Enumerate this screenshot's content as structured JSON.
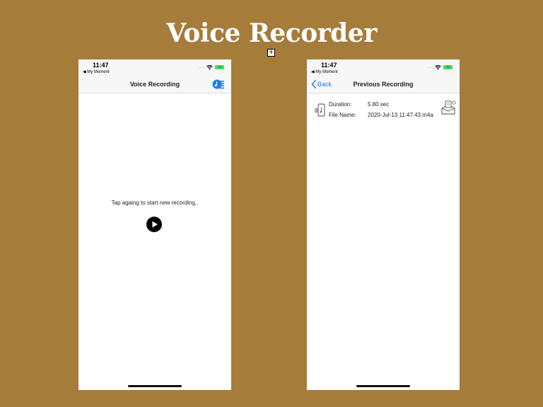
{
  "slide": {
    "title": "Voice Recorder"
  },
  "colors": {
    "background": "#a67c3b",
    "accent": "#1a7cf4",
    "battery": "#4cd964"
  },
  "screens": [
    {
      "status": {
        "time": "11:47",
        "back_app": "◀ My Moment",
        "battery_label": "74",
        "signal": "....."
      },
      "nav": {
        "title": "Voice Recording",
        "action_icon": "recordings-list-icon"
      },
      "prompt": "Tap againg to start new recording..",
      "play_icon": "play-icon"
    },
    {
      "status": {
        "time": "11:47",
        "back_app": "◀ My Moment",
        "battery_label": "74",
        "signal": "....."
      },
      "nav": {
        "title": "Previous Recording",
        "back_label": "Back"
      },
      "recording": {
        "icon": "audio-file-icon",
        "duration_label": "Duration:",
        "duration_value": "5.80 sec",
        "filename_label": "File Name:",
        "filename_value": "2020-Jul-13 11:47:43.m4a",
        "share_icon": "share-icon"
      }
    }
  ]
}
